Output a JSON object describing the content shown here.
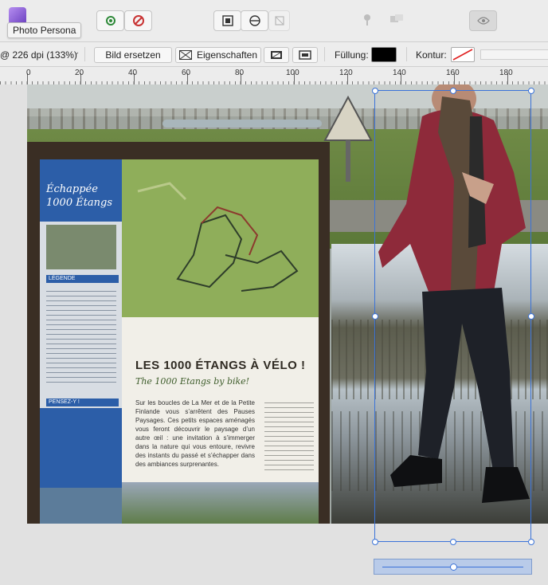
{
  "toolbar": {
    "persona_tooltip": "Photo Persona"
  },
  "context_toolbar": {
    "zoom_label": "@ 226 dpi (133%)",
    "replace_image_button": "Bild ersetzen",
    "properties_button": "Eigenschaften",
    "fill_label": "Füllung:",
    "stroke_label": "Kontur:",
    "fill_color": "#000000"
  },
  "ruler": {
    "labels": [
      "0",
      "20",
      "40",
      "60",
      "80",
      "100",
      "120",
      "140",
      "160",
      "180"
    ]
  },
  "poster": {
    "brand_line1": "Échappée",
    "brand_line2": "1000 Étangs",
    "legend_label": "LÉGENDE",
    "pensez_label": "PENSEZ-Y !",
    "headline": "LES 1000 ÉTANGS À VÉLO !",
    "subheadline": "The 1000 Etangs by bike!",
    "body": "Sur les boucles de La Mer et de la Petite Finlande vous s’arrêtent des Pauses Paysages. Ces petits espaces aménagés vous feront découvrir le paysage d’un autre œil : une invitation à s’immerger dans la nature qui vous entoure, revivre des instants du passé et s’échapper dans des ambiances surprenantes."
  },
  "colors": {
    "accent_selection": "#3b73d8",
    "poster_blue": "#2c5ea8",
    "poster_green": "#8fae5a"
  }
}
